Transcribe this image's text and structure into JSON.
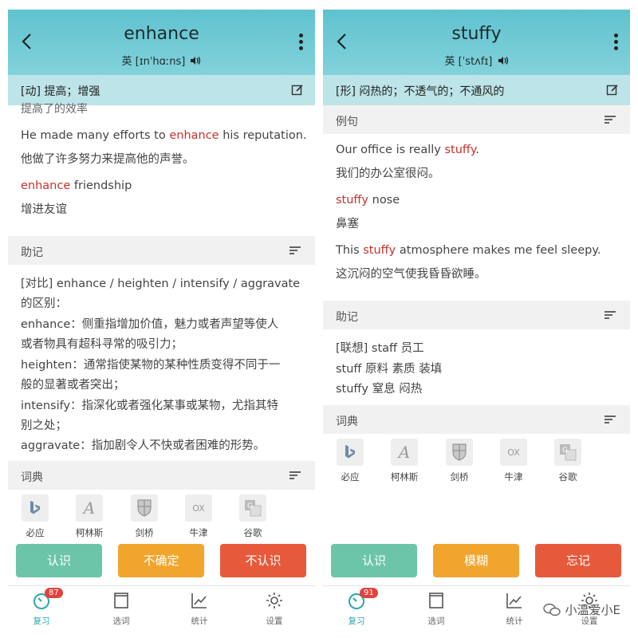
{
  "left": {
    "header": {
      "word": "enhance",
      "phonetic_prefix": "英",
      "phonetic": "[ɪnˈhɑːns]"
    },
    "definition": "[动] 提高；增强",
    "cutoff_text": "提高了的效率",
    "examples": [
      {
        "en_parts": [
          "He made many efforts to ",
          "enhance",
          " his reputation."
        ],
        "cn": "他做了许多努力来提高他的声誉。"
      },
      {
        "en_parts": [
          "",
          "enhance",
          " friendship"
        ],
        "cn": "增进友谊"
      }
    ],
    "mnemonic_title": "助记",
    "mnemonic_lines": [
      "[对比] enhance / heighten / intensify / aggravate",
      "的区别：",
      "enhance：侧重指增加价值，魅力或者声望等使人",
      "或者物具有超科寻常的吸引力；",
      "heighten：通常指使某物的某种性质变得不同于一",
      "般的显著或者突出；",
      "intensify：指深化或者强化某事或某物，尤指其特",
      "别之处；",
      "aggravate：指加剧令人不快或者困难的形势。"
    ],
    "dict_title": "词典",
    "dicts": [
      "必应",
      "柯林斯",
      "剑桥",
      "牛津",
      "谷歌"
    ],
    "buttons": [
      "认识",
      "不确定",
      "不认识"
    ],
    "nav": [
      "复习",
      "选词",
      "统计",
      "设置"
    ],
    "badge": "87"
  },
  "right": {
    "header": {
      "word": "stuffy",
      "phonetic_prefix": "英",
      "phonetic": "[ˈstʌfɪ]"
    },
    "definition": "[形] 闷热的；不透气的；不通风的",
    "example_title": "例句",
    "examples": [
      {
        "en_parts": [
          "Our office is really ",
          "stuffy",
          "."
        ],
        "cn": "我们的办公室很闷。"
      },
      {
        "en_parts": [
          "",
          "stuffy",
          " nose"
        ],
        "cn": "鼻塞"
      },
      {
        "en_parts": [
          "This ",
          "stuffy",
          " atmosphere makes me feel sleepy."
        ],
        "cn": "这沉闷的空气使我昏昏欲睡。"
      }
    ],
    "mnemonic_title": "助记",
    "mnemonic_lines": [
      "[联想] staff 员工",
      "stuff 原料 素质 装填",
      "stuffy 窒息 闷热"
    ],
    "dict_title": "词典",
    "dicts": [
      "必应",
      "柯林斯",
      "剑桥",
      "牛津",
      "谷歌"
    ],
    "buttons": [
      "认识",
      "模糊",
      "忘记"
    ],
    "nav": [
      "复习",
      "选词",
      "统计",
      "设置"
    ],
    "badge": "91"
  },
  "watermark": "小温爱小E",
  "colors": {
    "accent": "#5fc2cf",
    "highlight": "#c8312b",
    "btn_know": "#6cc4a9",
    "btn_unsure": "#f1a52d",
    "btn_forget": "#e7593b"
  }
}
